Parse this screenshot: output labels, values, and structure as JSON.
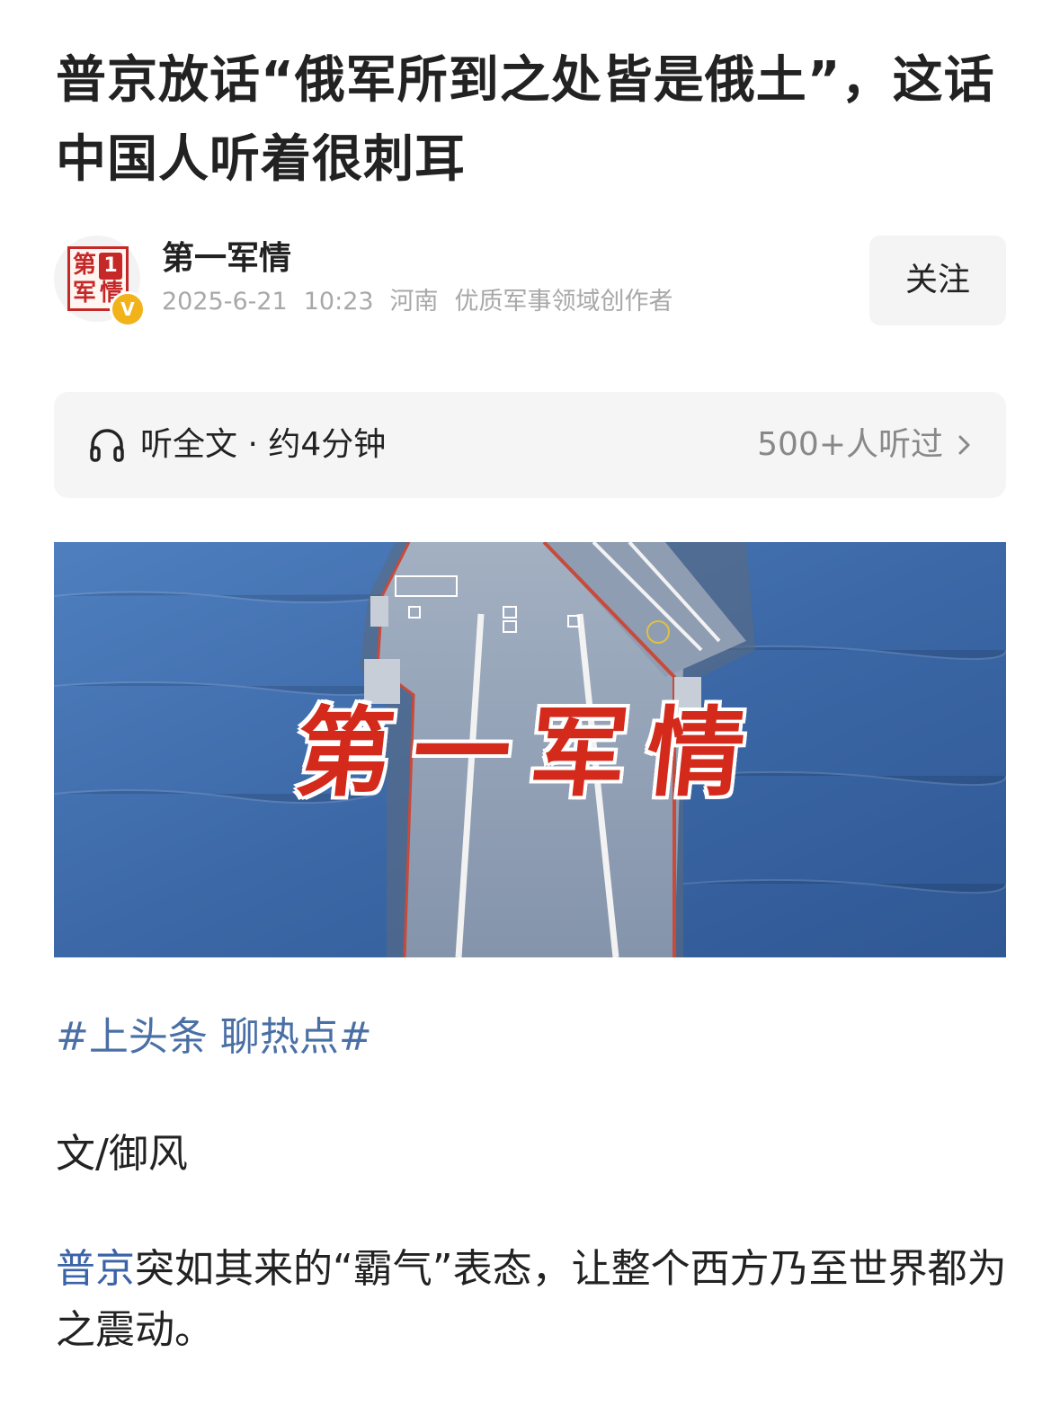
{
  "article": {
    "title": "普京放话“俄军所到之处皆是俄土”，这话中国人听着很刺耳"
  },
  "author": {
    "name": "第一军情",
    "avatar_text": [
      "第",
      "军",
      "情"
    ],
    "avatar_badge": "1",
    "verified_badge": "V",
    "date": "2025-6-21",
    "time": "10:23",
    "location": "河南",
    "tag": "优质军事领域创作者",
    "follow_label": "关注"
  },
  "listen": {
    "icon": "headphones-icon",
    "label": "听全文 · 约4分钟",
    "count": "500+人听过",
    "chevron": "chevron-right-icon"
  },
  "hero": {
    "caption": "第一军情"
  },
  "content": {
    "hashtag": "#上头条 聊热点#",
    "byline": "文/御风",
    "paragraph_link": "普京",
    "paragraph_text": "突如其来的“霸气”表态，让整个西方乃至世界都为之震动。"
  },
  "colors": {
    "link": "#3b63a8",
    "hashtag": "#4a6fa5",
    "meta_gray": "#a8a8a8",
    "brand_red": "#c62828",
    "verified_gold": "#f2b21a",
    "sea_blue": "#3f6aa6"
  }
}
